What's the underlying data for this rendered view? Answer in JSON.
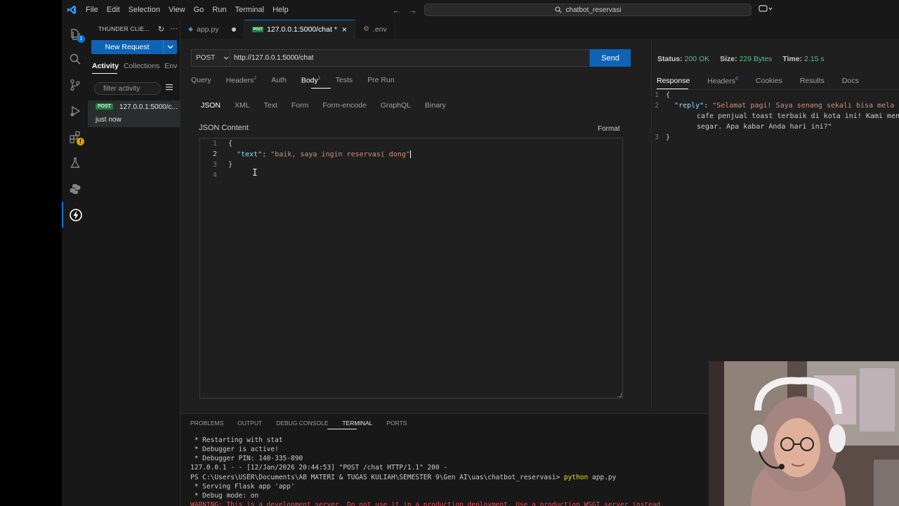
{
  "window": {
    "menu": [
      "File",
      "Edit",
      "Selection",
      "View",
      "Go",
      "Run",
      "Terminal",
      "Help"
    ],
    "search_text": "chatbot_reservasi"
  },
  "sidebar": {
    "title": "THUNDER CLIE...",
    "new_request_label": "New Request",
    "tabs": [
      "Activity",
      "Collections",
      "Env"
    ],
    "filter_placeholder": "filter activity",
    "activity": [
      {
        "method": "POST",
        "url": "127.0.0.1:5000/c...",
        "time": "just now"
      }
    ]
  },
  "editor_tabs": [
    {
      "label": "app.py",
      "modified": true,
      "active": false
    },
    {
      "label": "127.0.0.1:5000/chat *",
      "modified": false,
      "active": true
    },
    {
      "label": ".env",
      "modified": false,
      "active": false
    }
  ],
  "request": {
    "method": "POST",
    "url": "http://127.0.0.1:5000/chat",
    "send_label": "Send",
    "tabs": {
      "query": "Query",
      "headers": "Headers",
      "headers_count": "2",
      "auth": "Auth",
      "body": "Body",
      "body_count": "1",
      "tests": "Tests",
      "prerun": "Pre Run"
    },
    "body_tabs": [
      "JSON",
      "XML",
      "Text",
      "Form",
      "Form-encode",
      "GraphQL",
      "Binary"
    ],
    "json_label": "JSON Content",
    "format_label": "Format",
    "code": {
      "l1": "{",
      "key": "\"text\"",
      "colon": ": ",
      "value": "\"baik, saya ingin reservasi dong\"",
      "l3": "}",
      "line_numbers": [
        "1",
        "2",
        "3",
        "4"
      ]
    }
  },
  "response": {
    "status_label": "Status:",
    "status_value": "200 OK",
    "size_label": "Size:",
    "size_value": "229 Bytes",
    "time_label": "Time:",
    "time_value": "2.15 s",
    "tabs": {
      "response": "Response",
      "headers": "Headers",
      "headers_count": "6",
      "cookies": "Cookies",
      "results": "Results",
      "docs": "Docs"
    },
    "code": {
      "l1": "{",
      "key": "\"reply\"",
      "colon": ": ",
      "value_1": "\"Selamat pagi! Saya senang sekali bisa mela",
      "value_2": "cafe penjual toast terbaik di kota ini! Kami men",
      "value_3": "segar. Apa kabar Anda hari ini?\"",
      "l3": "}",
      "line_numbers": [
        "1",
        "2",
        "3"
      ]
    }
  },
  "panel": {
    "tabs": [
      "PROBLEMS",
      "OUTPUT",
      "DEBUG CONSOLE",
      "TERMINAL",
      "PORTS"
    ],
    "terminal": {
      "l1": " * Restarting with stat",
      "l2": " * Debugger is active!",
      "l3": " * Debugger PIN: 140-335-890",
      "l4": "127.0.0.1 - - [12/Jan/2026 20:44:53] \"POST /chat HTTP/1.1\" 200 -",
      "l5_prompt": "PS C:\\Users\\USER\\Documents\\AB MATERI & TUGAS KULIAH\\SEMESTER 9\\Gen AI\\uas\\chatbot_reservasi> ",
      "l5_cmd": "python",
      "l5_arg": " app.py",
      "l6": " * Serving Flask app 'app'",
      "l7": " * Debug mode: on",
      "l8": "WARNING: This is a development server. Do not use it in a production deployment. Use a production WSGI server instead."
    }
  },
  "colors": {
    "accent": "#0078d4",
    "button": "#0e63b4",
    "success": "#4ec18f",
    "method_post": "#1f7f3f",
    "warning": "#f14c4c"
  }
}
